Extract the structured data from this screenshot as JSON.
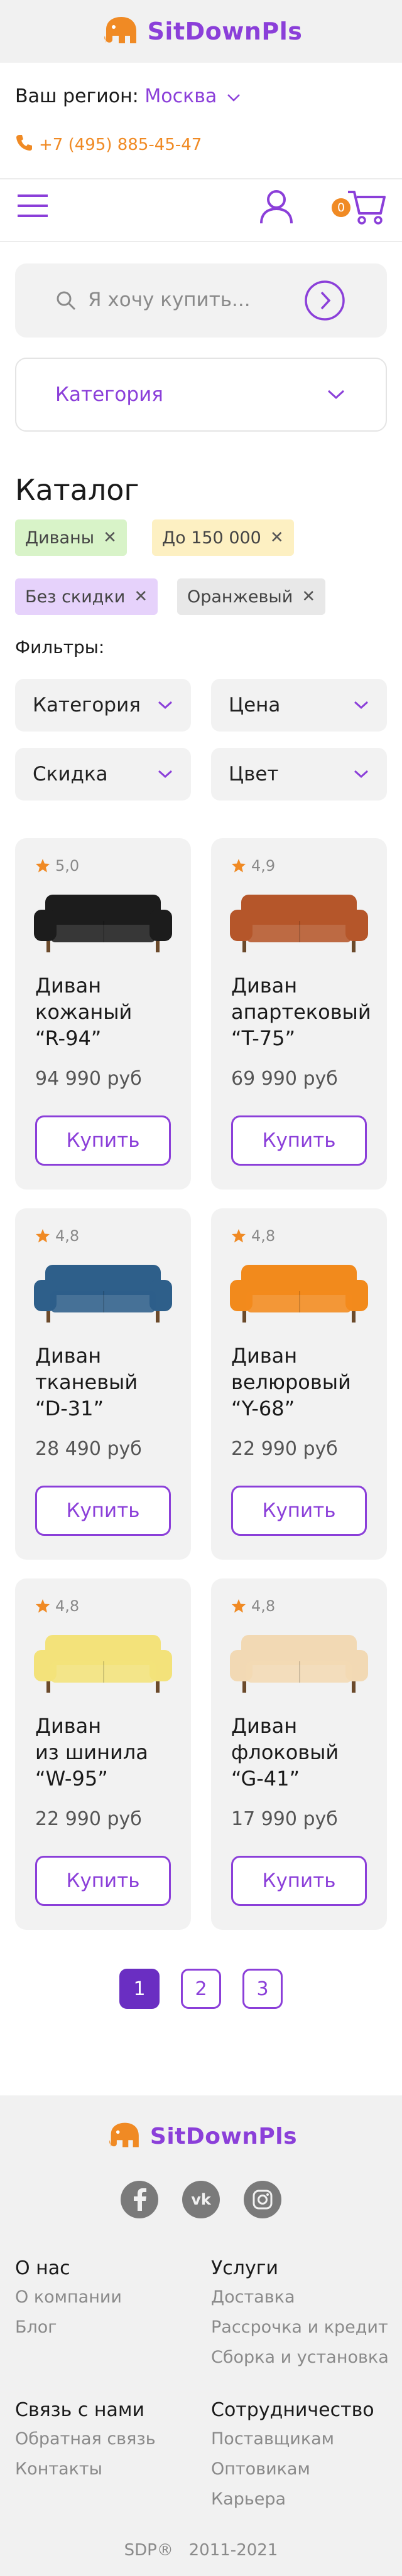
{
  "brand": {
    "name": "SitDownPls"
  },
  "region": {
    "label": "Ваш регион:",
    "city": "Москва"
  },
  "phone": {
    "number": "+7 (495) 885-45-47"
  },
  "cart": {
    "count": "0"
  },
  "search": {
    "placeholder": "Я хочу купить..."
  },
  "category_select": {
    "label": "Категория"
  },
  "catalog": {
    "title": "Каталог",
    "chips": [
      {
        "label": "Диваны",
        "bg": "#d8f3c8"
      },
      {
        "label": "До 150 000",
        "bg": "#fdf0c2"
      },
      {
        "label": "Без скидки",
        "bg": "#e6d2fb"
      },
      {
        "label": "Оранжевый",
        "bg": "#e8e8e8"
      }
    ],
    "filters_label": "Фильтры:",
    "filters": [
      "Категория",
      "Цена",
      "Скидка",
      "Цвет"
    ]
  },
  "products": [
    {
      "rating": "5,0",
      "name_l1": "Диван",
      "name_l2": "кожаный",
      "name_l3": "“R-94”",
      "price": "94 990 руб",
      "buy": "Купить",
      "color": "#1c1c1c"
    },
    {
      "rating": "4,9",
      "name_l1": "Диван",
      "name_l2": "апартековый",
      "name_l3": "“T-75”",
      "price": "69 990 руб",
      "buy": "Купить",
      "color": "#b5562a"
    },
    {
      "rating": "4,8",
      "name_l1": "Диван",
      "name_l2": "тканевый",
      "name_l3": "“D-31”",
      "price": "28 490 руб",
      "buy": "Купить",
      "color": "#2e5f8a"
    },
    {
      "rating": "4,8",
      "name_l1": "Диван",
      "name_l2": "велюровый",
      "name_l3": "“Y-68”",
      "price": "22 990 руб",
      "buy": "Купить",
      "color": "#f28a1c"
    },
    {
      "rating": "4,8",
      "name_l1": "Диван",
      "name_l2": "из шинила",
      "name_l3": "“W-95”",
      "price": "22 990 руб",
      "buy": "Купить",
      "color": "#f3e27a"
    },
    {
      "rating": "4,8",
      "name_l1": "Диван",
      "name_l2": "флоковый",
      "name_l3": "“G-41”",
      "price": "17 990 руб",
      "buy": "Купить",
      "color": "#f2d9b4"
    }
  ],
  "pagination": {
    "pages": [
      "1",
      "2",
      "3"
    ],
    "active": "1"
  },
  "footer": {
    "about": {
      "title": "О нас",
      "links": [
        "О компании",
        "Блог"
      ]
    },
    "services": {
      "title": "Услуги",
      "links": [
        "Доставка",
        "Рассрочка и кредит",
        "Сборка и установка"
      ]
    },
    "contact": {
      "title": "Связь с нами",
      "links": [
        "Обратная связь",
        "Контакты"
      ]
    },
    "partners": {
      "title": "Сотрудничество",
      "links": [
        "Поставщикам",
        "Оптовикам",
        "Карьера"
      ]
    },
    "copyright": "SDP®   2011-2021"
  },
  "colors": {
    "accent": "#8b3fd9",
    "orange": "#f08a24"
  },
  "icons": [
    "elephant-logo-icon",
    "chevron-down-icon",
    "phone-icon",
    "menu-icon",
    "user-icon",
    "cart-icon",
    "search-icon",
    "arrow-right-icon",
    "star-icon",
    "close-icon",
    "facebook-icon",
    "vk-icon",
    "instagram-icon"
  ]
}
